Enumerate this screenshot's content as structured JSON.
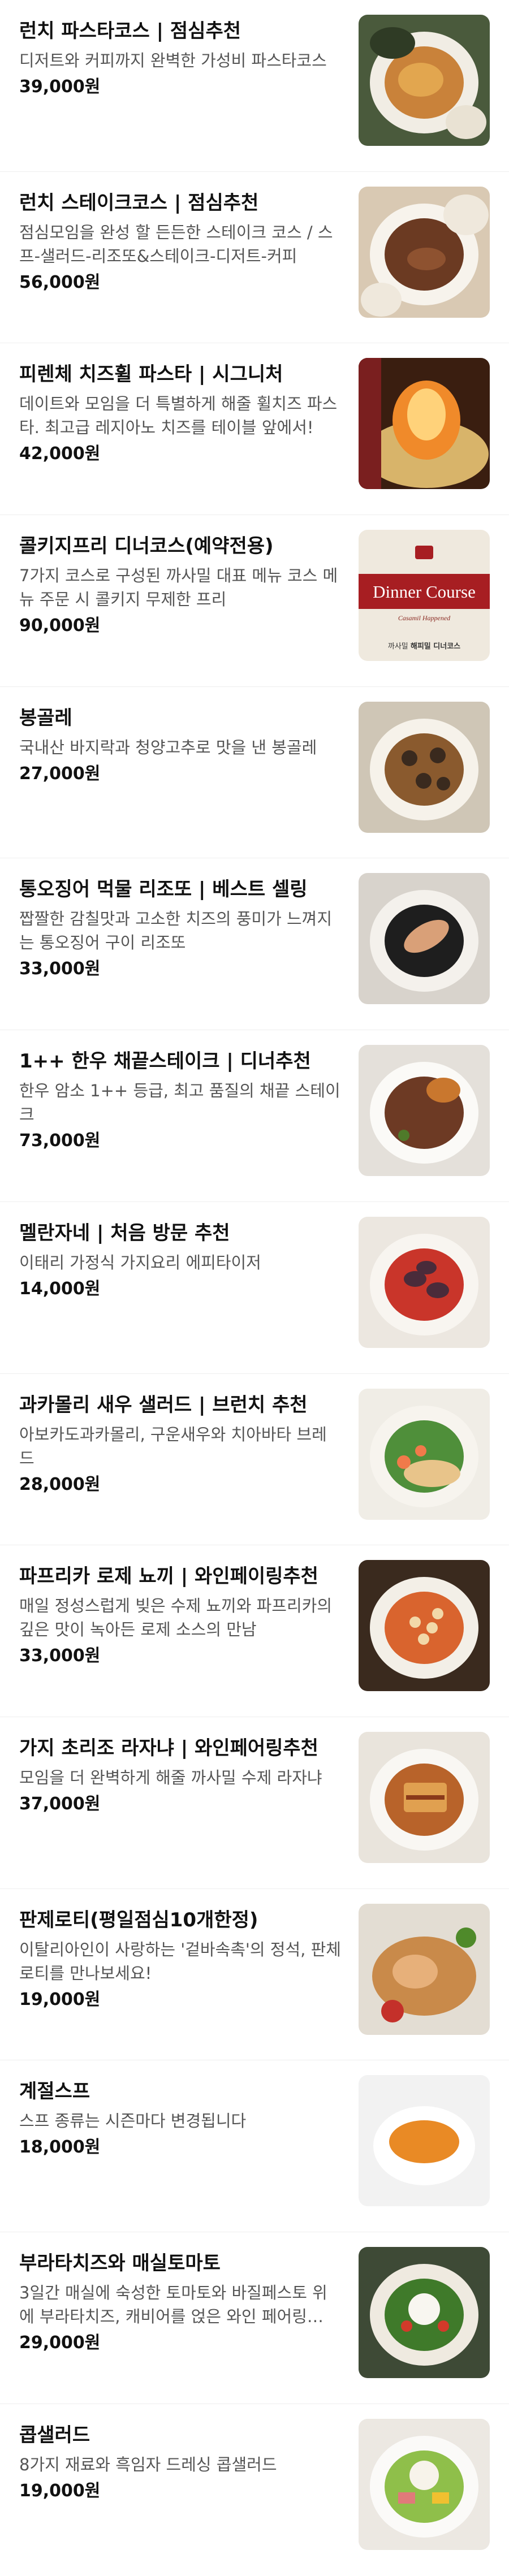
{
  "items": [
    {
      "name": "런치 파스타코스 | 점심추천",
      "desc": "디저트와 커피까지 완벽한 가성비 파스타코스",
      "price": "39,000원",
      "image": "pasta-course-table-photo"
    },
    {
      "name": "런치 스테이크코스 | 점심추천",
      "desc": "점심모임을 완성 할 든든한 스테이크 코스 / 스프-샐러드-리조또&스테이크-디저트-커피",
      "price": "56,000원",
      "image": "steak-course-table-photo"
    },
    {
      "name": "피렌체 치즈휠 파스타 | 시그니처",
      "desc": "데이트와 모임을 더 특별하게 해줄 휠치즈 파스타. 최고급 레지아노 치즈를 테이블 앞에서!",
      "price": "42,000원",
      "image": "flaming-cheese-wheel-photo"
    },
    {
      "name": "콜키지프리 디너코스(예약전용)",
      "desc": "7가지 코스로 구성된 까사밀 대표 메뉴 코스 메뉴 주문 시 콜키지 무제한 프리",
      "price": "90,000원",
      "image": "dinner-course-card",
      "card": {
        "title": "Dinner Course",
        "subtitle": "Casamil Happened",
        "footer_small": "까사밀",
        "footer_bold": "해피밀 디너코스"
      }
    },
    {
      "name": "봉골레",
      "desc": "국내산 바지락과 청양고추로 맛을 낸 봉골레",
      "price": "27,000원",
      "image": "vongole-pasta-photo"
    },
    {
      "name": "통오징어 먹물 리조또 | 베스트 셀링",
      "desc": "짭짤한 감칠맛과 고소한 치즈의 풍미가 느껴지는 통오징어 구이 리조또",
      "price": "33,000원",
      "image": "squid-ink-risotto-photo"
    },
    {
      "name": "1++ 한우 채끝스테이크 | 디너추천",
      "desc": "한우 암소 1++ 등급, 최고 품질의 채끝 스테이크",
      "price": "73,000원",
      "image": "hanwoo-steak-photo"
    },
    {
      "name": "멜란자네 | 처음 방문 추천",
      "desc": "이태리 가정식 가지요리 에피타이저",
      "price": "14,000원",
      "image": "melanzane-photo"
    },
    {
      "name": "과카몰리 새우 샐러드 | 브런치 추천",
      "desc": "아보카도과카몰리, 구운새우와 치아바타 브레드",
      "price": "28,000원",
      "image": "guacamole-shrimp-salad-photo"
    },
    {
      "name": "파프리카 로제 뇨끼 | 와인페이링추천",
      "desc": "매일 정성스럽게 빚은 수제 뇨끼와 파프리카의 깊은 맛이 녹아든 로제 소스의 만남",
      "price": "33,000원",
      "image": "rose-gnocchi-photo"
    },
    {
      "name": "가지 초리조 라자냐 | 와인페어링추천",
      "desc": "모임을 더 완벽하게 해줄 까사밀 수제 라자냐",
      "price": "37,000원",
      "image": "lasagna-photo"
    },
    {
      "name": "판제로티(평일점심10개한정)",
      "desc": "이탈리아인이 사랑하는 '겉바속촉'의 정석, 판체로티를 만나보세요!",
      "price": "19,000원",
      "image": "panzerotti-photo"
    },
    {
      "name": "계절스프",
      "desc": "스프 종류는 시즌마다 변경됩니다",
      "price": "18,000원",
      "image": "seasonal-soup-photo"
    },
    {
      "name": "부라타치즈와 매실토마토",
      "desc": "3일간 매실에 숙성한 토마토와 바질페스토 위에 부라타치즈, 캐비어를 얹은 와인 페어링 메...",
      "price": "29,000원",
      "image": "burrata-tomato-photo"
    },
    {
      "name": "콥샐러드",
      "desc": "8가지 재료와 흑임자 드레싱 콥샐러드",
      "price": "19,000원",
      "image": "cobb-salad-photo"
    }
  ]
}
